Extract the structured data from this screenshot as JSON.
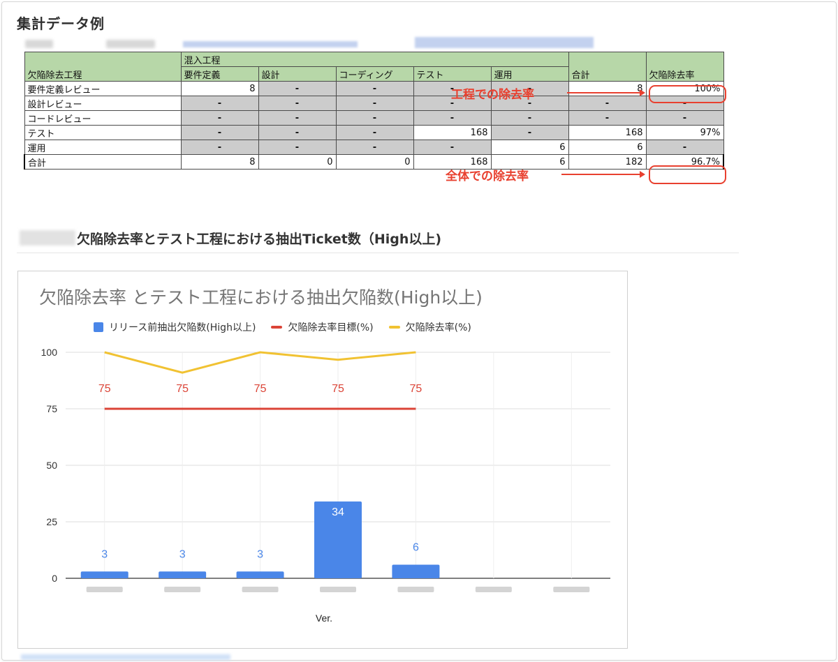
{
  "section1_title": "集計データ例",
  "table": {
    "col_header_group": "混入工程",
    "row_header_label": "欠陥除去工程",
    "columns": [
      "要件定義",
      "設計",
      "コーディング",
      "テスト",
      "運用",
      "合計",
      "欠陥除去率"
    ],
    "rows": [
      {
        "label": "要件定義レビュー",
        "cells": [
          "8",
          "-",
          "-",
          "-",
          "-",
          "8",
          "100%"
        ]
      },
      {
        "label": "設計レビュー",
        "cells": [
          "-",
          "-",
          "-",
          "-",
          "-",
          "-",
          "-"
        ]
      },
      {
        "label": "コードレビュー",
        "cells": [
          "-",
          "-",
          "-",
          "-",
          "-",
          "-",
          "-"
        ]
      },
      {
        "label": "テスト",
        "cells": [
          "-",
          "-",
          "-",
          "168",
          "-",
          "168",
          "97%"
        ]
      },
      {
        "label": "運用",
        "cells": [
          "-",
          "-",
          "-",
          "-",
          "6",
          "6",
          "-"
        ]
      },
      {
        "label": "合計",
        "cells": [
          "8",
          "0",
          "0",
          "168",
          "6",
          "182",
          "96.7%"
        ]
      }
    ]
  },
  "annotations": {
    "process_rate": "工程での除去率",
    "overall_rate": "全体での除去率"
  },
  "section2_title": "欠陥除去率とテスト工程における抽出Ticket数（High以上)",
  "chart_data": {
    "type": "bar",
    "title": "欠陥除去率 とテスト工程における抽出欠陥数(High以上)",
    "xlabel": "Ver.",
    "ylabel": "",
    "ylim": [
      0,
      100
    ],
    "yticks": [
      0,
      25,
      50,
      75,
      100
    ],
    "categories": [
      "",
      "",
      "",
      "",
      "",
      "",
      ""
    ],
    "series": [
      {
        "name": "リリース前抽出欠陥数(High以上)",
        "type": "bar",
        "color": "#4a86e8",
        "values": [
          3,
          3,
          3,
          34,
          6,
          null,
          null
        ],
        "labels": [
          "3",
          "3",
          "3",
          "34",
          "6"
        ]
      },
      {
        "name": "欠陥除去率目標(%)",
        "type": "line",
        "color": "#db4437",
        "values": [
          75,
          75,
          75,
          75,
          75,
          null,
          null
        ],
        "labels": [
          "75",
          "75",
          "75",
          "75",
          "75"
        ]
      },
      {
        "name": "欠陥除去率(%)",
        "type": "line",
        "color": "#f1c232",
        "values": [
          100,
          91,
          100,
          96.7,
          100,
          null,
          null
        ]
      }
    ],
    "grid": true,
    "legend": "top"
  }
}
